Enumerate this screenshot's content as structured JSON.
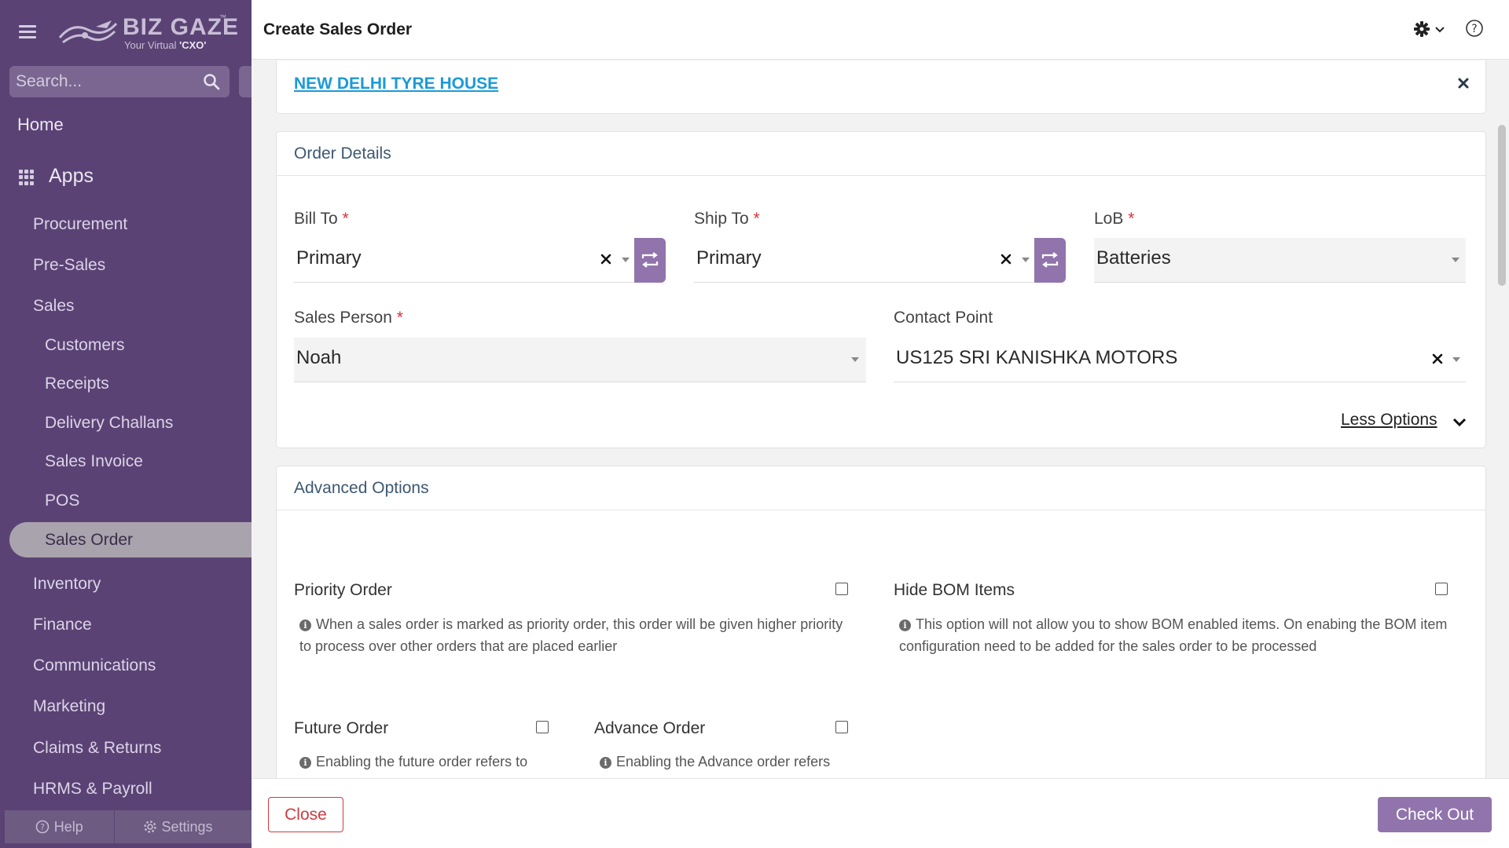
{
  "app": {
    "logo_text": "BIZ GAZE",
    "logo_tm": "™",
    "tagline_prefix": "Your Virtual ",
    "tagline_bold": "'CXO'"
  },
  "sidebar": {
    "search_placeholder": "Search...",
    "home": "Home",
    "apps": "Apps",
    "items": [
      {
        "label": "Procurement"
      },
      {
        "label": "Pre-Sales"
      },
      {
        "label": "Sales"
      },
      {
        "label": "Customers"
      },
      {
        "label": "Receipts"
      },
      {
        "label": "Delivery Challans"
      },
      {
        "label": "Sales Invoice"
      },
      {
        "label": "POS"
      },
      {
        "label": "Sales Order"
      },
      {
        "label": "Inventory"
      },
      {
        "label": "Finance"
      },
      {
        "label": "Communications"
      },
      {
        "label": "Marketing"
      },
      {
        "label": "Claims & Returns"
      },
      {
        "label": "HRMS & Payroll"
      }
    ],
    "footer": {
      "help": "Help",
      "settings": "Settings"
    }
  },
  "header": {
    "title": "Create Sales Order"
  },
  "customer": {
    "name": "NEW DELHI TYRE HOUSE"
  },
  "order_details": {
    "heading": "Order Details",
    "bill_to": {
      "label": "Bill To",
      "value": "Primary"
    },
    "ship_to": {
      "label": "Ship To",
      "value": "Primary"
    },
    "lob": {
      "label": "LoB",
      "value": "Batteries"
    },
    "sales_person": {
      "label": "Sales Person",
      "value": "Noah"
    },
    "contact_point": {
      "label": "Contact Point",
      "value": "US125 SRI KANISHKA MOTORS"
    },
    "required_mark": "*",
    "less_options": "Less Options"
  },
  "advanced": {
    "heading": "Advanced Options",
    "priority_order": {
      "label": "Priority Order",
      "help": "When a sales order is marked as priority order, this order will be given higher priority to process over other orders that are placed earlier"
    },
    "hide_bom": {
      "label": "Hide BOM Items",
      "help": "This option will not allow you to show BOM enabled items. On enabing the BOM item configuration need to be added for the sales order to be processed"
    },
    "future_order": {
      "label": "Future Order",
      "help": "Enabling the future order refers to"
    },
    "advance_order": {
      "label": "Advance Order",
      "help": "Enabling the Advance order refers"
    }
  },
  "footer": {
    "close": "Close",
    "checkout": "Check Out"
  },
  "colors": {
    "sidebar": "#5a4374",
    "accent": "#9074ab",
    "link": "#1b9ad6",
    "danger": "#d03a3f"
  }
}
